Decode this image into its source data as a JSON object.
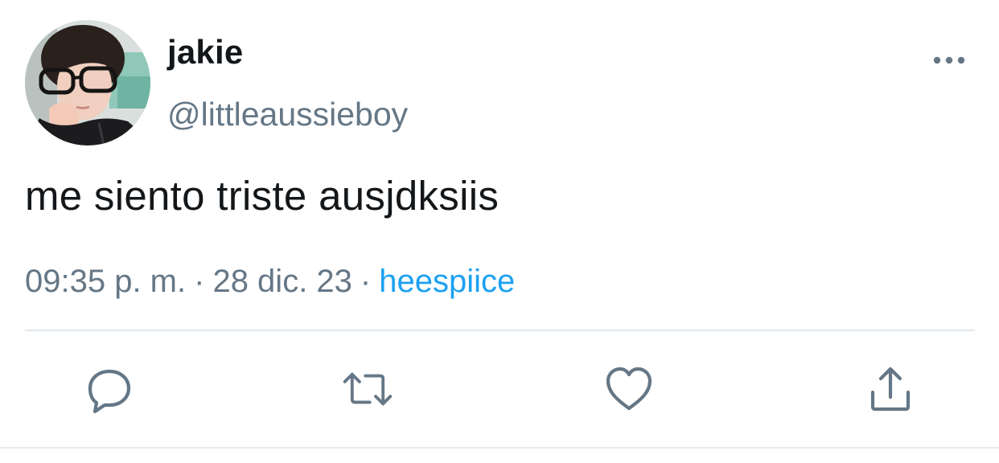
{
  "user": {
    "display_name": "jakie",
    "handle": "@littleaussieboy",
    "avatar_icon": "profile-photo"
  },
  "tweet": {
    "text": "me siento triste ausjdksiis"
  },
  "meta": {
    "time": "09:35 p. m.",
    "separator": "·",
    "date": "28 dic. 23",
    "source": "heespiice"
  },
  "actions": {
    "reply_icon": "reply-icon",
    "retweet_icon": "retweet-icon",
    "like_icon": "heart-icon",
    "share_icon": "share-icon"
  },
  "colors": {
    "text": "#14171a",
    "secondary": "#657786",
    "link": "#1da1f2",
    "divider": "#e1e8ed"
  }
}
